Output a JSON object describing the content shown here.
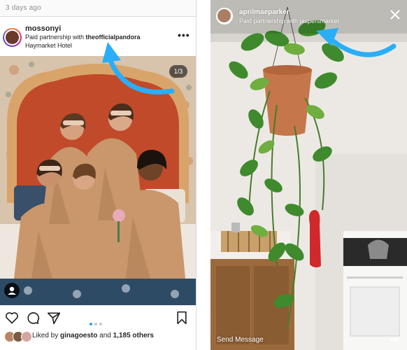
{
  "feed_post": {
    "timestamp": "3 days ago",
    "username": "mossonyi",
    "partnership_prefix": "Paid partnership with ",
    "partner": "theofficialpandora",
    "location": "Haymarket Hotel",
    "more_glyph": "•••",
    "carousel_counter": "1/3",
    "carousel_dots_total": 3,
    "carousel_dots_active": 1,
    "actions": [
      "heart-icon",
      "comment-icon",
      "share-icon",
      "bookmark-icon"
    ],
    "liked_by_prefix": "Liked by ",
    "liked_by_user": "ginagoesto",
    "liked_by_conjunction": " and ",
    "liked_by_others": "1,185 others"
  },
  "story": {
    "username": "aprilmaeparker",
    "partnership_prefix": "Paid partnership with ",
    "partner": "jaspersmarket",
    "close_glyph": "✕",
    "send_message_placeholder": "Send Message",
    "menu_glyph": "•••"
  },
  "colors": {
    "annotation_arrow": "#29aef7",
    "link_blue": "#3897f0",
    "text": "#262626"
  }
}
